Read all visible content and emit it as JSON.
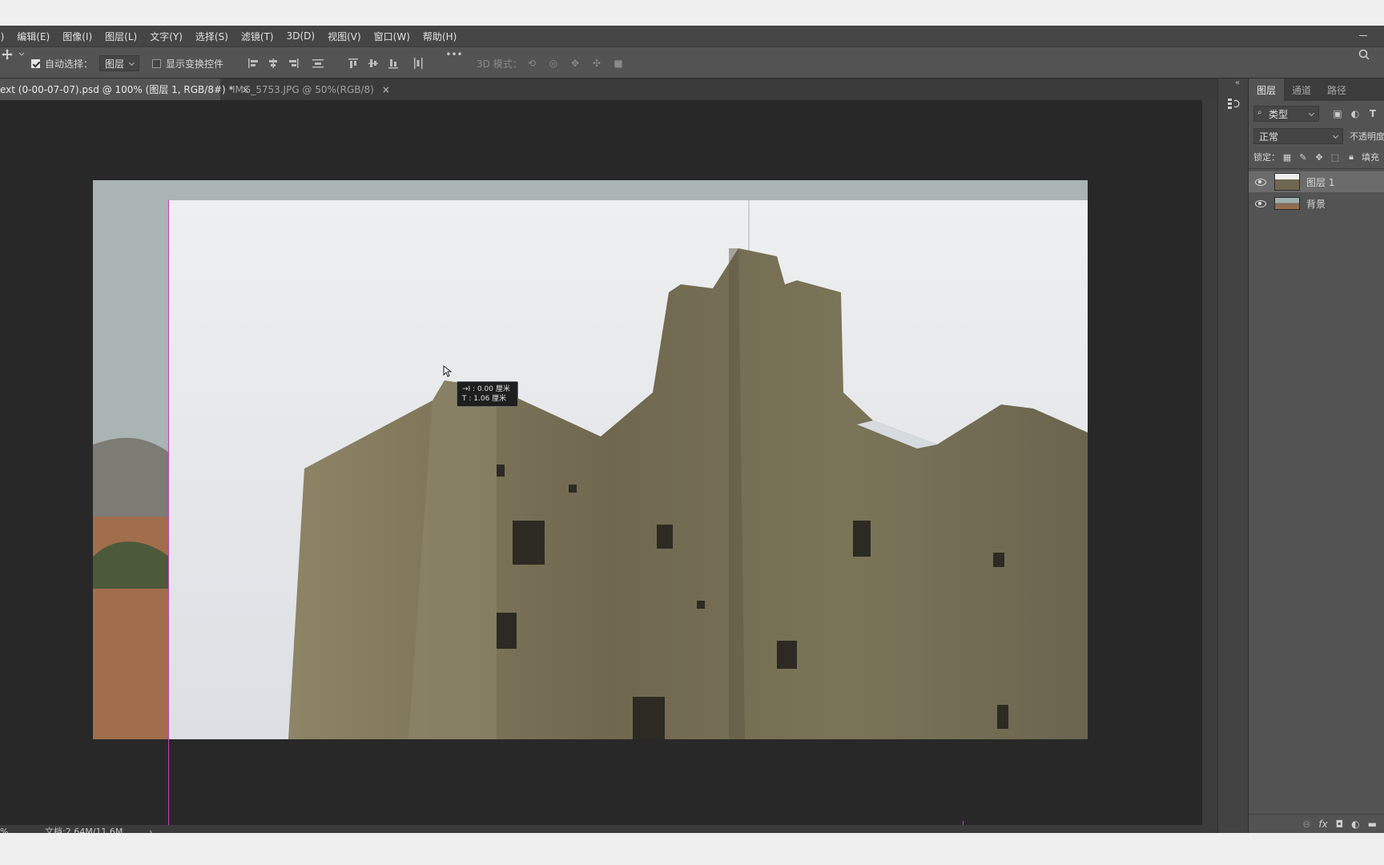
{
  "menu": [
    "文件(F)",
    "编辑(E)",
    "图像(I)",
    "图层(L)",
    "文字(Y)",
    "选择(S)",
    "滤镜(T)",
    "3D(D)",
    "视图(V)",
    "窗口(W)",
    "帮助(H)"
  ],
  "options": {
    "auto_select_label": "自动选择：",
    "auto_select_value": "图层",
    "show_transform_label": "显示变换控件",
    "more": "•••",
    "mode_3d": "3D 模式："
  },
  "tabs": [
    {
      "label": "ext (0-00-07-07).psd @ 100% (图层 1, RGB/8#) *",
      "close": "×"
    },
    {
      "label": "IMG_5753.JPG @ 50%(RGB/8)",
      "close": "×"
    }
  ],
  "measure_tip": {
    "line1": "→I :  0.00 厘米",
    "line2": "T :  1.06 厘米"
  },
  "status": {
    "zoom": "%",
    "doc": "文档:2.64M/11.6M",
    "arrow": "›"
  },
  "panel": {
    "tabs": [
      "图层",
      "通道",
      "路径"
    ],
    "filter_label": "类型",
    "blend_mode": "正常",
    "opacity_label": "不透明度",
    "lock_label": "锁定：",
    "fill_label": "填充",
    "layers": [
      {
        "name": "图层 1",
        "selected": true
      },
      {
        "name": "背景",
        "selected": false
      }
    ]
  },
  "colors": {
    "guide": "#c43fc5",
    "canvas_bg": "#282828",
    "ui": "#535353"
  }
}
